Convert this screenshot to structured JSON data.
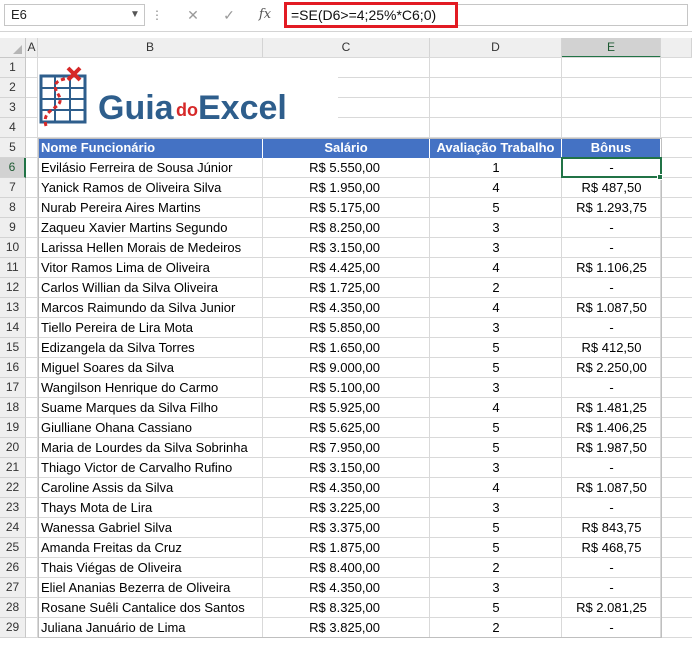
{
  "formula_bar": {
    "name_box": "E6",
    "formula": "=SE(D6>=4;25%*C6;0)",
    "cancel_icon": "close-icon",
    "enter_icon": "check-icon",
    "fx_label": "fx"
  },
  "columns": [
    "A",
    "B",
    "C",
    "D",
    "E"
  ],
  "selected_column": "E",
  "selected_row": 6,
  "logo": {
    "part1": "Guia",
    "part2": "do",
    "part3": "Excel"
  },
  "table": {
    "headers": [
      "Nome Funcionário",
      "Salário",
      "Avaliação Trabalho",
      "Bônus"
    ],
    "rows": [
      [
        "Evilásio Ferreira de Sousa Júnior",
        "R$ 5.550,00",
        "1",
        "-"
      ],
      [
        "Yanick Ramos de Oliveira Silva",
        "R$ 1.950,00",
        "4",
        "R$ 487,50"
      ],
      [
        "Nurab Pereira Aires Martins",
        "R$ 5.175,00",
        "5",
        "R$ 1.293,75"
      ],
      [
        "Zaqueu Xavier Martins Segundo",
        "R$ 8.250,00",
        "3",
        "-"
      ],
      [
        "Larissa Hellen Morais de Medeiros",
        "R$ 3.150,00",
        "3",
        "-"
      ],
      [
        "Vitor Ramos Lima de Oliveira",
        "R$ 4.425,00",
        "4",
        "R$ 1.106,25"
      ],
      [
        "Carlos Willian da Silva Oliveira",
        "R$ 1.725,00",
        "2",
        "-"
      ],
      [
        "Marcos Raimundo da Silva Junior",
        "R$ 4.350,00",
        "4",
        "R$ 1.087,50"
      ],
      [
        "Tiello Pereira de Lira Mota",
        "R$ 5.850,00",
        "3",
        "-"
      ],
      [
        "Edizangela da Silva Torres",
        "R$ 1.650,00",
        "5",
        "R$ 412,50"
      ],
      [
        "Miguel Soares da Silva",
        "R$ 9.000,00",
        "5",
        "R$ 2.250,00"
      ],
      [
        "Wangilson Henrique do Carmo",
        "R$ 5.100,00",
        "3",
        "-"
      ],
      [
        "Suame Marques da Silva Filho",
        "R$ 5.925,00",
        "4",
        "R$ 1.481,25"
      ],
      [
        "Giulliane Ohana Cassiano",
        "R$ 5.625,00",
        "5",
        "R$ 1.406,25"
      ],
      [
        "Maria de Lourdes da Silva Sobrinha",
        "R$ 7.950,00",
        "5",
        "R$ 1.987,50"
      ],
      [
        "Thiago Victor de Carvalho Rufino",
        "R$ 3.150,00",
        "3",
        "-"
      ],
      [
        "Caroline Assis da Silva",
        "R$ 4.350,00",
        "4",
        "R$ 1.087,50"
      ],
      [
        "Thays Mota de Lira",
        "R$ 3.225,00",
        "3",
        "-"
      ],
      [
        "Wanessa Gabriel Silva",
        "R$ 3.375,00",
        "5",
        "R$ 843,75"
      ],
      [
        "Amanda Freitas da Cruz",
        "R$ 1.875,00",
        "5",
        "R$ 468,75"
      ],
      [
        "Thais Viégas de Oliveira",
        "R$ 8.400,00",
        "2",
        "-"
      ],
      [
        "Eliel Ananias Bezerra de Oliveira",
        "R$ 4.350,00",
        "3",
        "-"
      ],
      [
        "Rosane Suêli Cantalice dos Santos",
        "R$ 8.325,00",
        "5",
        "R$ 2.081,25"
      ],
      [
        "Juliana Januário de Lima",
        "R$ 3.825,00",
        "2",
        "-"
      ]
    ]
  },
  "colors": {
    "header_blue": "#4472c4",
    "selection_green": "#217346",
    "formula_highlight": "#e21b23",
    "logo_blue": "#2e5e8c",
    "logo_red": "#d62828"
  }
}
